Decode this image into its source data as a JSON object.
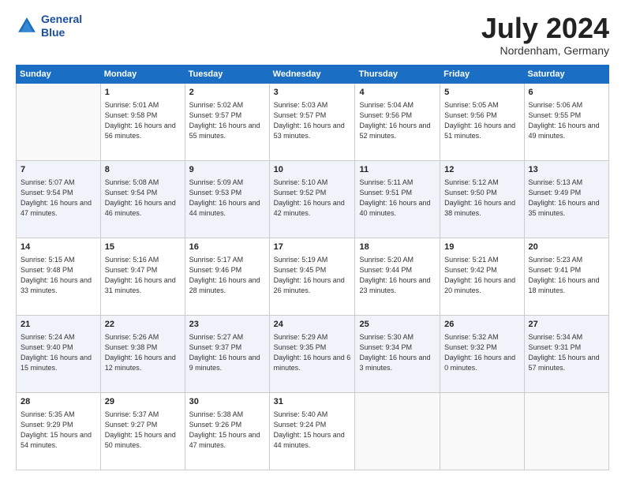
{
  "logo": {
    "line1": "General",
    "line2": "Blue"
  },
  "title": "July 2024",
  "location": "Nordenham, Germany",
  "days_header": [
    "Sunday",
    "Monday",
    "Tuesday",
    "Wednesday",
    "Thursday",
    "Friday",
    "Saturday"
  ],
  "weeks": [
    [
      {
        "day": null
      },
      {
        "day": "1",
        "sunrise": "Sunrise: 5:01 AM",
        "sunset": "Sunset: 9:58 PM",
        "daylight": "Daylight: 16 hours and 56 minutes."
      },
      {
        "day": "2",
        "sunrise": "Sunrise: 5:02 AM",
        "sunset": "Sunset: 9:57 PM",
        "daylight": "Daylight: 16 hours and 55 minutes."
      },
      {
        "day": "3",
        "sunrise": "Sunrise: 5:03 AM",
        "sunset": "Sunset: 9:57 PM",
        "daylight": "Daylight: 16 hours and 53 minutes."
      },
      {
        "day": "4",
        "sunrise": "Sunrise: 5:04 AM",
        "sunset": "Sunset: 9:56 PM",
        "daylight": "Daylight: 16 hours and 52 minutes."
      },
      {
        "day": "5",
        "sunrise": "Sunrise: 5:05 AM",
        "sunset": "Sunset: 9:56 PM",
        "daylight": "Daylight: 16 hours and 51 minutes."
      },
      {
        "day": "6",
        "sunrise": "Sunrise: 5:06 AM",
        "sunset": "Sunset: 9:55 PM",
        "daylight": "Daylight: 16 hours and 49 minutes."
      }
    ],
    [
      {
        "day": "7",
        "sunrise": "Sunrise: 5:07 AM",
        "sunset": "Sunset: 9:54 PM",
        "daylight": "Daylight: 16 hours and 47 minutes."
      },
      {
        "day": "8",
        "sunrise": "Sunrise: 5:08 AM",
        "sunset": "Sunset: 9:54 PM",
        "daylight": "Daylight: 16 hours and 46 minutes."
      },
      {
        "day": "9",
        "sunrise": "Sunrise: 5:09 AM",
        "sunset": "Sunset: 9:53 PM",
        "daylight": "Daylight: 16 hours and 44 minutes."
      },
      {
        "day": "10",
        "sunrise": "Sunrise: 5:10 AM",
        "sunset": "Sunset: 9:52 PM",
        "daylight": "Daylight: 16 hours and 42 minutes."
      },
      {
        "day": "11",
        "sunrise": "Sunrise: 5:11 AM",
        "sunset": "Sunset: 9:51 PM",
        "daylight": "Daylight: 16 hours and 40 minutes."
      },
      {
        "day": "12",
        "sunrise": "Sunrise: 5:12 AM",
        "sunset": "Sunset: 9:50 PM",
        "daylight": "Daylight: 16 hours and 38 minutes."
      },
      {
        "day": "13",
        "sunrise": "Sunrise: 5:13 AM",
        "sunset": "Sunset: 9:49 PM",
        "daylight": "Daylight: 16 hours and 35 minutes."
      }
    ],
    [
      {
        "day": "14",
        "sunrise": "Sunrise: 5:15 AM",
        "sunset": "Sunset: 9:48 PM",
        "daylight": "Daylight: 16 hours and 33 minutes."
      },
      {
        "day": "15",
        "sunrise": "Sunrise: 5:16 AM",
        "sunset": "Sunset: 9:47 PM",
        "daylight": "Daylight: 16 hours and 31 minutes."
      },
      {
        "day": "16",
        "sunrise": "Sunrise: 5:17 AM",
        "sunset": "Sunset: 9:46 PM",
        "daylight": "Daylight: 16 hours and 28 minutes."
      },
      {
        "day": "17",
        "sunrise": "Sunrise: 5:19 AM",
        "sunset": "Sunset: 9:45 PM",
        "daylight": "Daylight: 16 hours and 26 minutes."
      },
      {
        "day": "18",
        "sunrise": "Sunrise: 5:20 AM",
        "sunset": "Sunset: 9:44 PM",
        "daylight": "Daylight: 16 hours and 23 minutes."
      },
      {
        "day": "19",
        "sunrise": "Sunrise: 5:21 AM",
        "sunset": "Sunset: 9:42 PM",
        "daylight": "Daylight: 16 hours and 20 minutes."
      },
      {
        "day": "20",
        "sunrise": "Sunrise: 5:23 AM",
        "sunset": "Sunset: 9:41 PM",
        "daylight": "Daylight: 16 hours and 18 minutes."
      }
    ],
    [
      {
        "day": "21",
        "sunrise": "Sunrise: 5:24 AM",
        "sunset": "Sunset: 9:40 PM",
        "daylight": "Daylight: 16 hours and 15 minutes."
      },
      {
        "day": "22",
        "sunrise": "Sunrise: 5:26 AM",
        "sunset": "Sunset: 9:38 PM",
        "daylight": "Daylight: 16 hours and 12 minutes."
      },
      {
        "day": "23",
        "sunrise": "Sunrise: 5:27 AM",
        "sunset": "Sunset: 9:37 PM",
        "daylight": "Daylight: 16 hours and 9 minutes."
      },
      {
        "day": "24",
        "sunrise": "Sunrise: 5:29 AM",
        "sunset": "Sunset: 9:35 PM",
        "daylight": "Daylight: 16 hours and 6 minutes."
      },
      {
        "day": "25",
        "sunrise": "Sunrise: 5:30 AM",
        "sunset": "Sunset: 9:34 PM",
        "daylight": "Daylight: 16 hours and 3 minutes."
      },
      {
        "day": "26",
        "sunrise": "Sunrise: 5:32 AM",
        "sunset": "Sunset: 9:32 PM",
        "daylight": "Daylight: 16 hours and 0 minutes."
      },
      {
        "day": "27",
        "sunrise": "Sunrise: 5:34 AM",
        "sunset": "Sunset: 9:31 PM",
        "daylight": "Daylight: 15 hours and 57 minutes."
      }
    ],
    [
      {
        "day": "28",
        "sunrise": "Sunrise: 5:35 AM",
        "sunset": "Sunset: 9:29 PM",
        "daylight": "Daylight: 15 hours and 54 minutes."
      },
      {
        "day": "29",
        "sunrise": "Sunrise: 5:37 AM",
        "sunset": "Sunset: 9:27 PM",
        "daylight": "Daylight: 15 hours and 50 minutes."
      },
      {
        "day": "30",
        "sunrise": "Sunrise: 5:38 AM",
        "sunset": "Sunset: 9:26 PM",
        "daylight": "Daylight: 15 hours and 47 minutes."
      },
      {
        "day": "31",
        "sunrise": "Sunrise: 5:40 AM",
        "sunset": "Sunset: 9:24 PM",
        "daylight": "Daylight: 15 hours and 44 minutes."
      },
      {
        "day": null
      },
      {
        "day": null
      },
      {
        "day": null
      }
    ]
  ]
}
